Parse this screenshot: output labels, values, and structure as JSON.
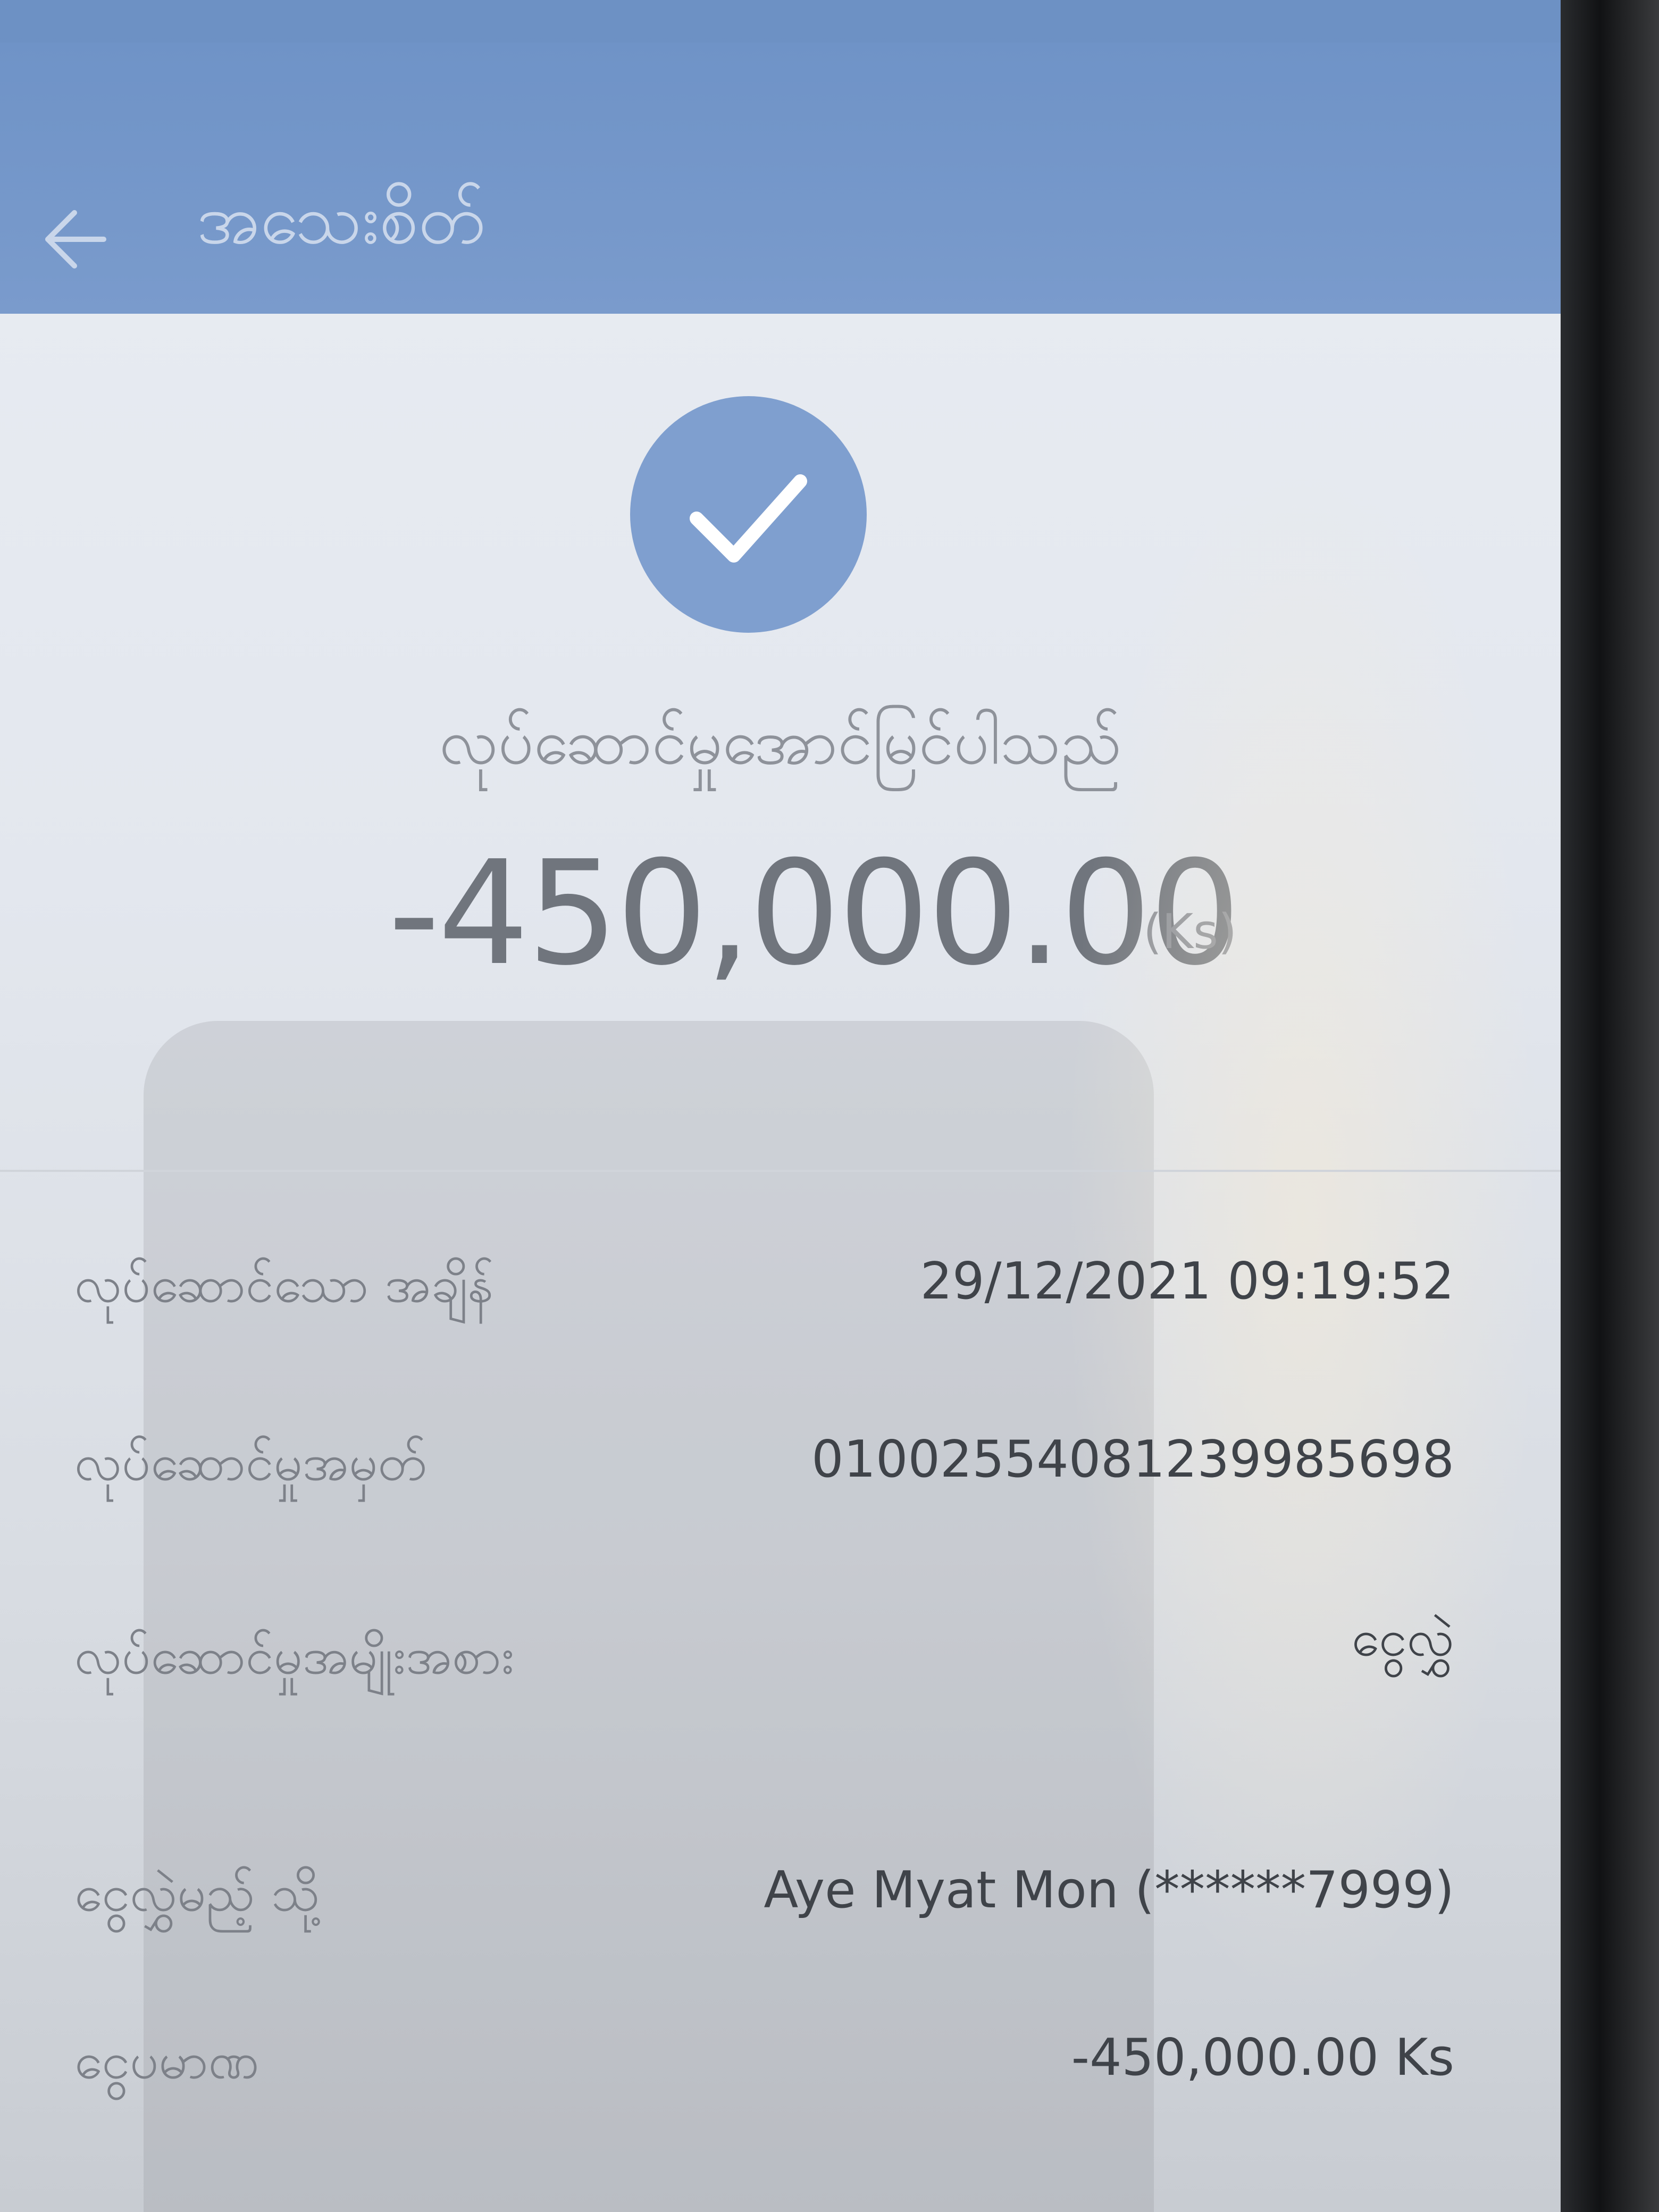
{
  "app_bar": {
    "title": "အသေးစိတ်"
  },
  "result": {
    "status": "လုပ်ဆောင်မှုအောင်မြင်ပါသည်",
    "amount": "-450,000.00",
    "unit": "(Ks)"
  },
  "details": [
    {
      "label": "လုပ်ဆောင်သော အချိန်",
      "value": "29/12/2021 09:19:52"
    },
    {
      "label": "လုပ်ဆောင်မှုအမှတ်",
      "value": "01002554081239985698"
    },
    {
      "label": "လုပ်ဆောင်မှုအမျိုးအစား",
      "value": "ငွေလွှဲ"
    },
    {
      "label": "ငွေလွှဲမည့် သို့",
      "value": "Aye Myat Mon (******7999)"
    },
    {
      "label": "ငွေပမာဏ",
      "value": "-450,000.00 Ks"
    }
  ],
  "colors": {
    "app_bar": "#7a9bcc",
    "success_circle": "#7f9fcf",
    "background": "#e6eaf0"
  },
  "icons": {
    "back": "arrow-left-icon",
    "success": "checkmark-icon"
  }
}
